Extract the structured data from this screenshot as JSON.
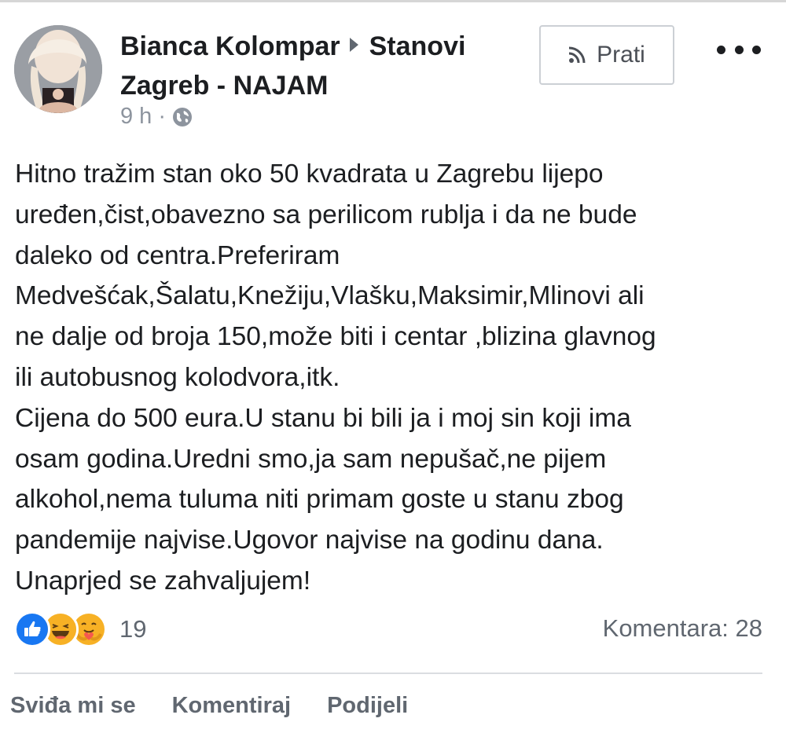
{
  "post": {
    "author": "Bianca Kolompar",
    "group": "Stanovi Zagreb - NAJAM",
    "time": "9 h",
    "dot": "·",
    "follow_label": "Prati",
    "body_lines": [
      "Hitno tražim stan oko 50 kvadrata u Zagrebu lijepo",
      "uređen,čist,obavezno sa perilicom rublja i da ne bude",
      "daleko od centra.Preferiram",
      "Medvešćak,Šalatu,Knežiju,Vlašku,Maksimir,Mlinovi ali",
      "ne dalje od broja 150,može biti i centar ,blizina glavnog",
      "ili autobusnog kolodvora,itk.",
      "Cijena do 500 eura.U stanu bi bili ja i moj sin koji ima",
      "osam godina.Uredni smo,ja sam nepušač,ne pijem",
      "alkohol,nema tuluma niti primam goste u stanu zbog",
      "pandemije najvise.Ugovor najvise na godinu dana.",
      "Unaprjed se zahvaljujem!"
    ],
    "reaction_icons": [
      "like-icon",
      "haha-icon",
      "care-icon"
    ],
    "reaction_count": "19",
    "comments_label": "Komentara: 28"
  },
  "actions": {
    "like": "Sviđa mi se",
    "comment": "Komentiraj",
    "share": "Podijeli"
  },
  "colors": {
    "like_blue": "#1877f2",
    "reaction_yellow": "#f7b125",
    "secondary_text": "#606770"
  }
}
